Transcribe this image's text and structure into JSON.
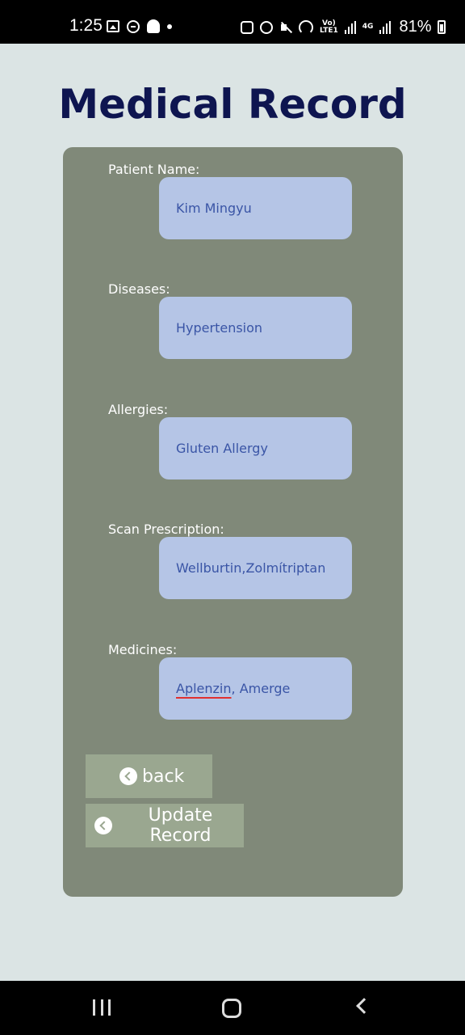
{
  "status_bar": {
    "time": "1:25",
    "network_label": "Vo)\nLTE1",
    "network_4g": "4G",
    "battery_percent": "81%"
  },
  "page": {
    "title": "Medical Record"
  },
  "form": {
    "patient_name": {
      "label": "Patient Name:",
      "value": "Kim Mingyu"
    },
    "diseases": {
      "label": "Diseases:",
      "value": "Hypertension"
    },
    "allergies": {
      "label": "Allergies:",
      "value": "Gluten Allergy"
    },
    "scan_prescription": {
      "label": "Scan Prescription:",
      "value": "Wellburtin,Zolmítriptan"
    },
    "medicines": {
      "label": "Medicines:",
      "value_misspelled": "Aplenzin",
      "value_rest": ", Amerge"
    }
  },
  "buttons": {
    "back_label": "back",
    "update_label": "Update Record"
  },
  "colors": {
    "background": "#dbe4e4",
    "card": "#808979",
    "field": "#b5c5e6",
    "field_text": "#3a55a6",
    "title": "#0e1550",
    "button": "#9aa790"
  }
}
